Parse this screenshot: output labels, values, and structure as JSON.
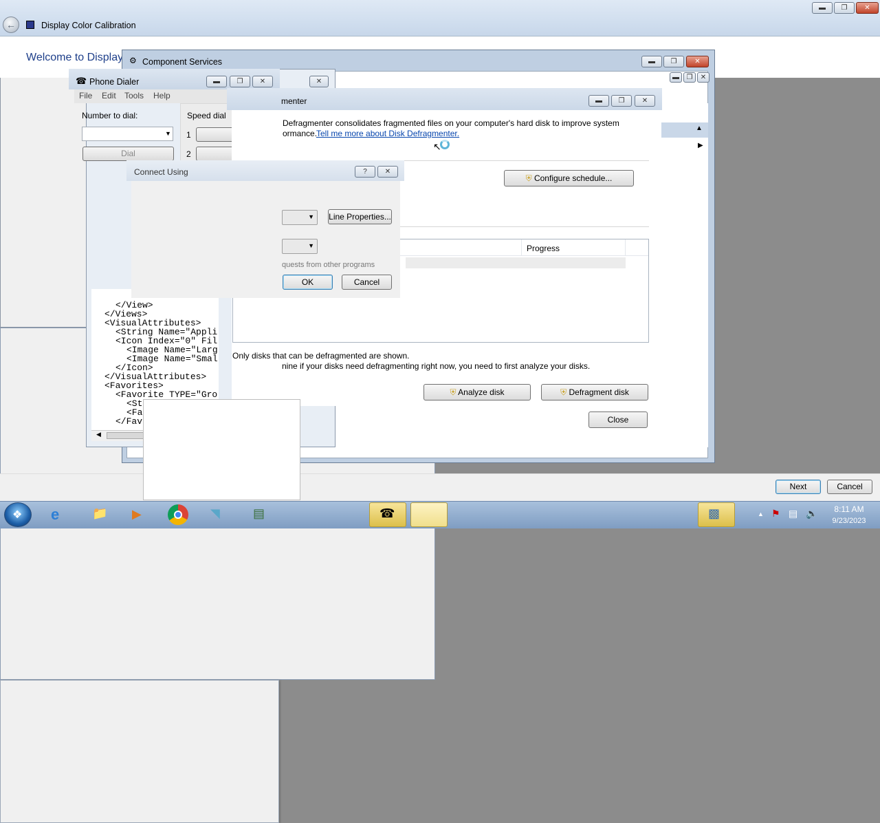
{
  "calibration": {
    "title": "Display Color Calibration",
    "heading": "Welcome to Display",
    "next_label": "Next",
    "cancel_label": "Cancel"
  },
  "component_services": {
    "title": "Component Services"
  },
  "phone_dialer": {
    "title": "Phone Dialer",
    "menu": [
      "File",
      "Edit",
      "Tools",
      "Help"
    ],
    "number_label": "Number to dial:",
    "speed_dial_label": "Speed dial",
    "speed_numbers": [
      "1",
      "2"
    ],
    "dial_label": "Dial"
  },
  "xml_lines": [
    "</View>",
    "</Views>",
    "<VisualAttributes>",
    "<String Name=\"Appli",
    "<Icon Index=\"0\" Fil",
    "<Image Name=\"Larg",
    "<Image Name=\"Smal",
    "</Icon>",
    "</VisualAttributes>",
    "<Favorites>",
    "<Favorite TYPE=\"Gro",
    "<St",
    "<Fa",
    "</Fav"
  ],
  "defrag": {
    "title": "menter",
    "description": "Defragmenter consolidates fragmented files on your computer's hard disk to improve system",
    "description2": "ormance.",
    "link": "Tell me more about Disk Defragmenter.",
    "configure_label": "Configure schedule...",
    "progress_header": "Progress",
    "only_disks": "Only disks that can be defragmented are shown.",
    "analyze_hint": "nine if your disks need defragmenting right now, you need to first analyze your disks.",
    "analyze_label": "Analyze disk",
    "defrag_label": "Defragment disk",
    "close_label": "Close"
  },
  "connect_using": {
    "title": "Connect Using",
    "help_glyph": "?",
    "line_properties_label": "Line Properties...",
    "requests_text": "quests from other programs",
    "ok_label": "OK",
    "cancel_label": "Cancel"
  },
  "taskbar": {
    "time": "8:11 AM",
    "date": "9/23/2023"
  },
  "colors": {
    "title_blue": "#1e3f8a",
    "link": "#0645ad",
    "taskbar": "#8fabcf"
  }
}
